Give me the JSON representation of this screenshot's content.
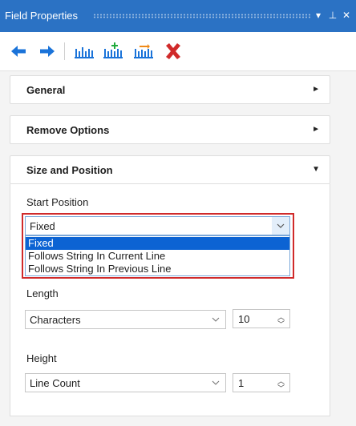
{
  "window": {
    "title": "Field Properties"
  },
  "titlebar_buttons": {
    "dropdown_icon": "▾",
    "pin_icon": "⊥",
    "close_icon": "✕"
  },
  "toolbar": {
    "items": [
      {
        "name": "back-arrow-icon",
        "color": "#1a73d9"
      },
      {
        "name": "forward-arrow-icon",
        "color": "#1a73d9"
      },
      {
        "name": "field-columns-icon",
        "color": "#1a73d9"
      },
      {
        "name": "add-field-icon",
        "color": "#1faa3c"
      },
      {
        "name": "move-field-icon",
        "color": "#f08a18"
      },
      {
        "name": "delete-icon",
        "color": "#d02a2a"
      }
    ]
  },
  "sections": {
    "general": {
      "label": "General",
      "arrow": "►"
    },
    "remove_options": {
      "label": "Remove Options",
      "arrow": "►"
    },
    "size_position": {
      "label": "Size and Position",
      "arrow": "▼"
    }
  },
  "start_position": {
    "label": "Start Position",
    "value": "Fixed",
    "options": [
      "Fixed",
      "Follows String In Current Line",
      "Follows String In Previous Line"
    ],
    "selected_index": 0
  },
  "length": {
    "label": "Length",
    "unit": "Characters",
    "value": "10"
  },
  "height": {
    "label": "Height",
    "unit": "Line Count",
    "value": "1"
  },
  "colors": {
    "titlebar": "#2b72c4",
    "selection": "#0c63d3",
    "highlight": "#d02a2a"
  }
}
